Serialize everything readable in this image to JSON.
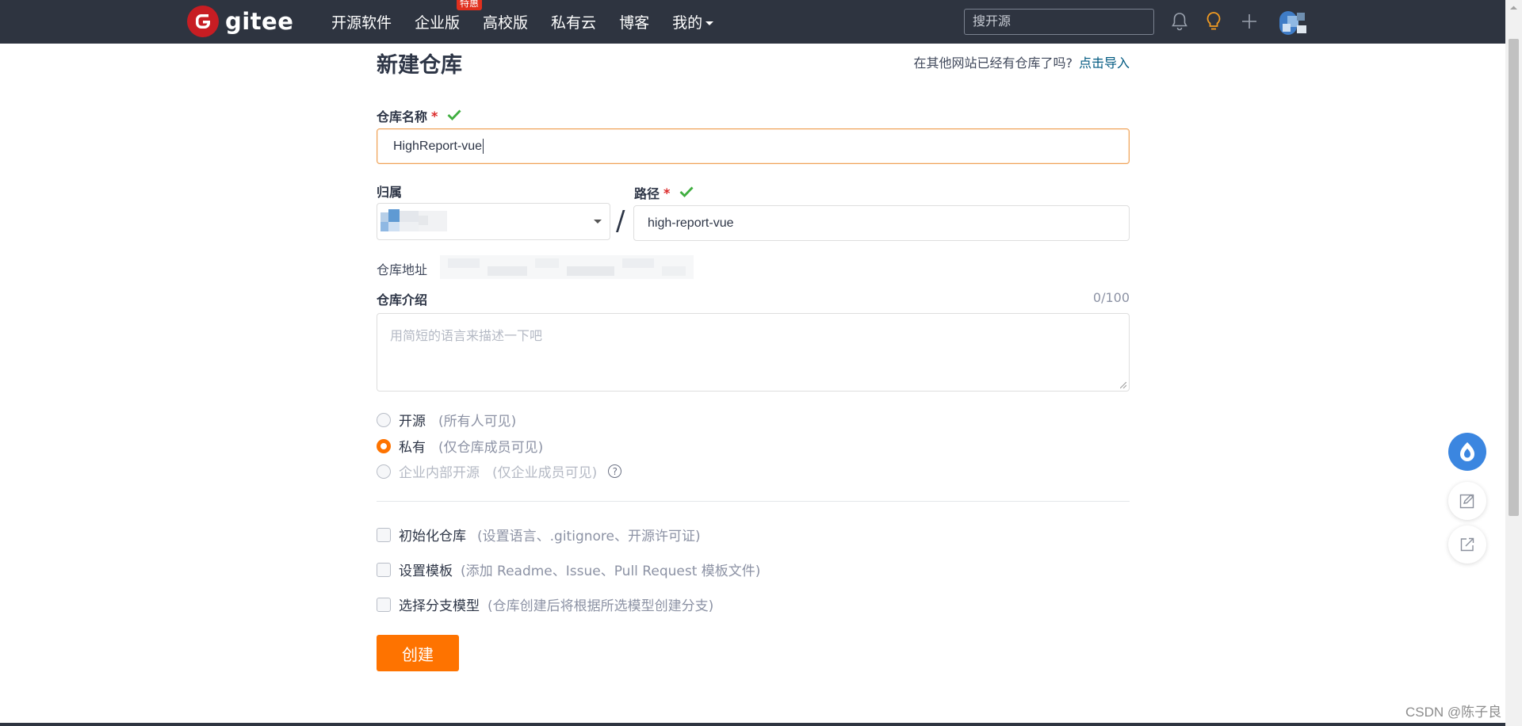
{
  "header": {
    "logo_text": "gitee",
    "nav": [
      {
        "label": "开源软件"
      },
      {
        "label": "企业版",
        "badge": "特惠"
      },
      {
        "label": "高校版"
      },
      {
        "label": "私有云"
      },
      {
        "label": "博客"
      },
      {
        "label": "我的",
        "has_dropdown": true
      }
    ],
    "search_placeholder": "搜开源",
    "icons": [
      "bell-icon",
      "lightbulb-icon",
      "plus-icon",
      "user-avatar"
    ]
  },
  "page": {
    "title": "新建仓库",
    "import_tip": "在其他网站已经有仓库了吗?",
    "import_link": "点击导入"
  },
  "form": {
    "repo_name_label": "仓库名称",
    "required_mark": "*",
    "repo_name_value": "HighReport-vue",
    "owner_label": "归属",
    "slash": "/",
    "path_label": "路径",
    "path_value": "high-report-vue",
    "address_label": "仓库地址",
    "description_label": "仓库介绍",
    "description_counter": "0/100",
    "description_placeholder": "用简短的语言来描述一下吧",
    "visibility": [
      {
        "label": "开源",
        "hint": "(所有人可见)",
        "selected": false,
        "disabled": false
      },
      {
        "label": "私有",
        "hint": "(仅仓库成员可见)",
        "selected": true,
        "disabled": false
      },
      {
        "label": "企业内部开源",
        "hint": "(仅企业成员可见)",
        "selected": false,
        "disabled": true
      }
    ],
    "options": [
      {
        "label": "初始化仓库",
        "hint": "(设置语言、.gitignore、开源许可证)",
        "checked": false
      },
      {
        "label": "设置模板",
        "hint": "(添加 Readme、Issue、Pull Request 模板文件)",
        "checked": false
      },
      {
        "label": "选择分支模型",
        "hint": "(仓库创建后将根据所选模型创建分支)",
        "checked": false
      }
    ],
    "create_button": "创建"
  },
  "watermark": "CSDN @陈子良",
  "colors": {
    "header_bg": "#2e3440",
    "accent": "#fe7300",
    "link": "#005980",
    "check": "#3fae3f",
    "logo_red": "#c71d23"
  }
}
